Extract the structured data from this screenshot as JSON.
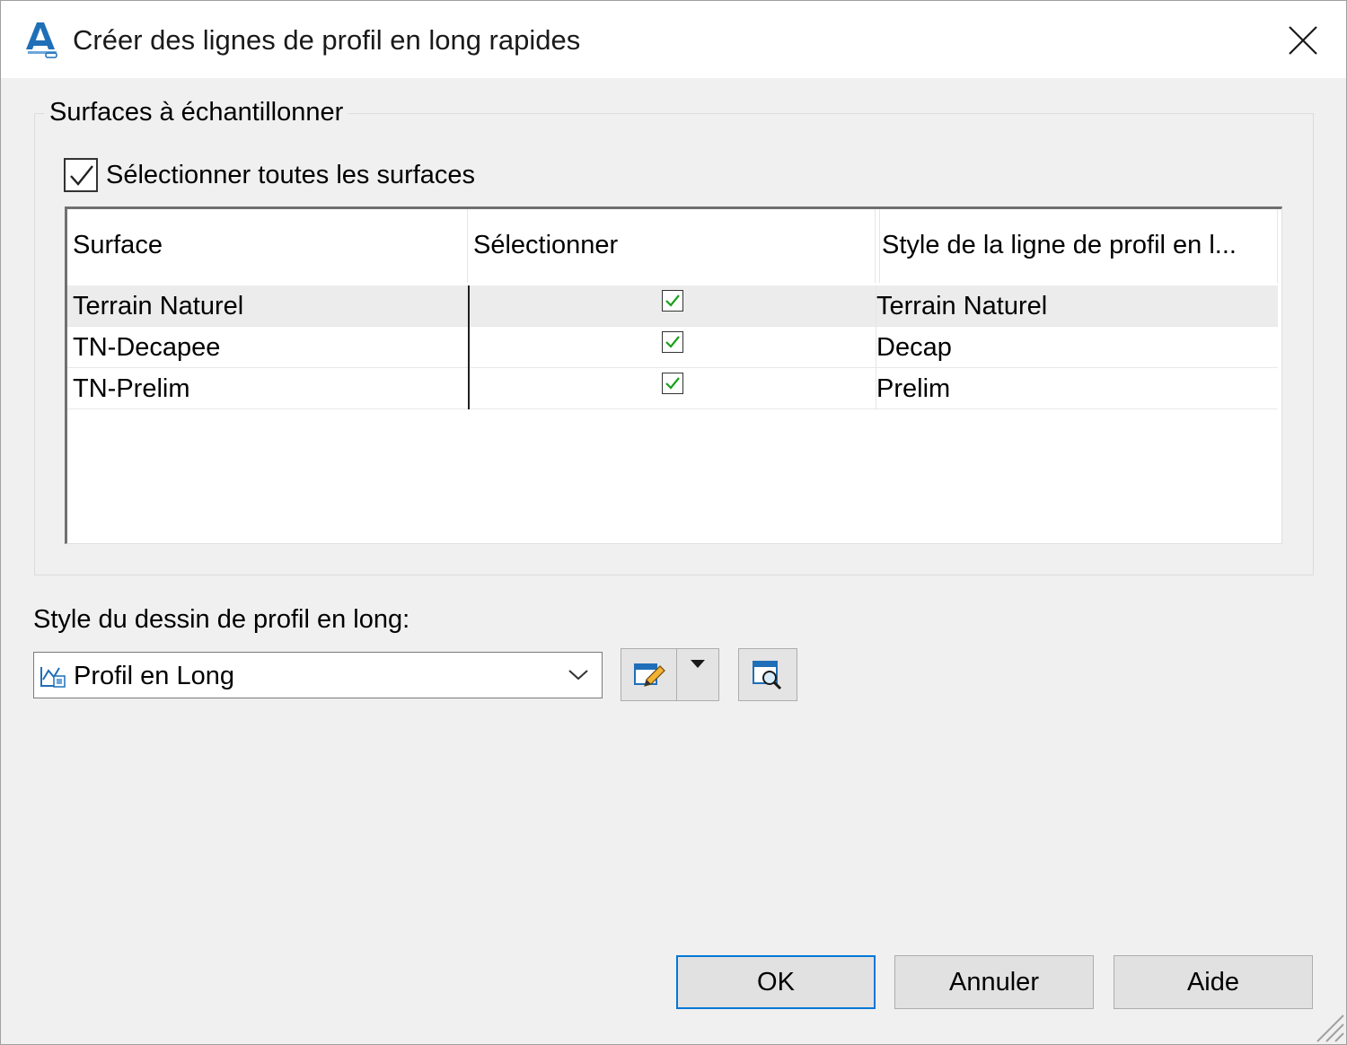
{
  "window": {
    "title": "Créer des lignes de profil en long rapides",
    "accent_color": "#0078d7"
  },
  "icons": {
    "app": "autocad-civil-icon",
    "close": "close-icon",
    "combo_item": "profile-view-style-icon",
    "edit": "edit-style-icon",
    "dropdown": "caret-down-icon",
    "preview": "preview-icon"
  },
  "surfaces_group": {
    "title": "Surfaces à échantillonner",
    "select_all_label": "Sélectionner toutes les surfaces",
    "select_all_checked": true,
    "columns": [
      "Surface",
      "Sélectionner",
      "Style de la ligne de profil en l..."
    ],
    "rows": [
      {
        "surface": "Terrain Naturel",
        "selected": true,
        "style": "Terrain Naturel"
      },
      {
        "surface": "TN-Decapee",
        "selected": true,
        "style": "Decap"
      },
      {
        "surface": "TN-Prelim",
        "selected": true,
        "style": "Prelim"
      }
    ]
  },
  "profile_view_style": {
    "label": "Style du dessin de profil en long:",
    "value": "Profil en Long"
  },
  "buttons": {
    "ok": "OK",
    "cancel": "Annuler",
    "help": "Aide"
  }
}
